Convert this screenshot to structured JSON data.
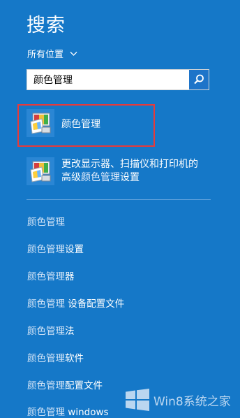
{
  "header": {
    "title": "搜索"
  },
  "scope": {
    "label": "所有位置"
  },
  "search": {
    "value": "颜色管理"
  },
  "results": [
    {
      "label": "颜色管理"
    },
    {
      "line1_pre": "更改显示器、扫描仪和打印机的",
      "line2_pre": "高级",
      "line2_hl": "颜色管理",
      "line2_post": "设置"
    }
  ],
  "suggestions": [
    {
      "base": "颜色管理",
      "extra": ""
    },
    {
      "base": "颜色管理",
      "extra": "设置"
    },
    {
      "base": "颜色管理",
      "extra": "器"
    },
    {
      "base": "颜色管理",
      "extra": " 设备配置文件"
    },
    {
      "base": "颜色管理",
      "extra": "法"
    },
    {
      "base": "颜色管理",
      "extra": "软件"
    },
    {
      "base": "颜色管理",
      "extra": "配置文件"
    },
    {
      "base": "颜色管理",
      "extra": " windows"
    }
  ],
  "watermark": {
    "text": "Win8系统之家"
  }
}
